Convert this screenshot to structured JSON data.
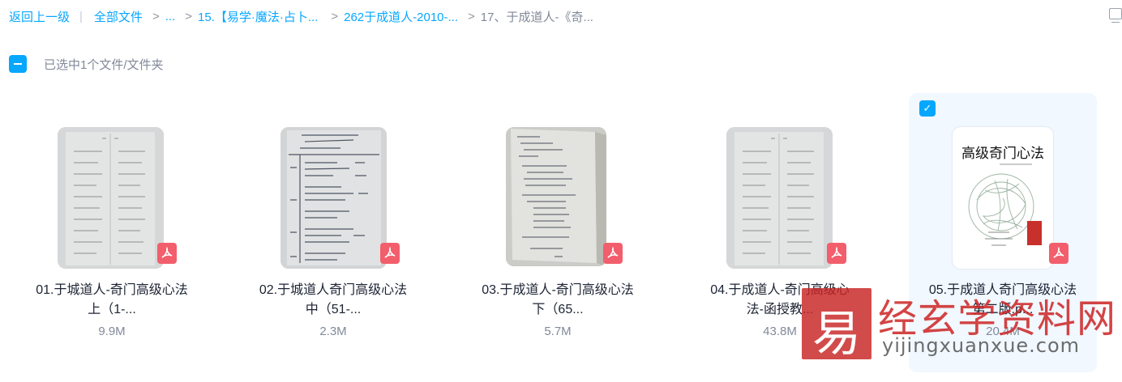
{
  "breadcrumb": {
    "back": "返回上一级",
    "all_files": "全部文件",
    "ellipsis": "...",
    "crumb_1": "15.【易学·魔法·占卜...",
    "crumb_2": "262于成道人-2010-...",
    "current": "17、于成道人-《奇..."
  },
  "selection": {
    "text": "已选中1个文件/文件夹"
  },
  "files": [
    {
      "line1": "01.于城道人-奇门高级心法",
      "line2": "上（1-...",
      "size": "9.9M"
    },
    {
      "line1": "02.于城道人奇门高级心法",
      "line2": "中（51-...",
      "size": "2.3M"
    },
    {
      "line1": "03.于成道人-奇门高级心法",
      "line2": "下（65...",
      "size": "5.7M"
    },
    {
      "line1": "04.于成道人-奇门高级心",
      "line2": "法-函授教...",
      "size": "43.8M"
    },
    {
      "line1": "05.于成道人奇门高级心法",
      "line2": "第二版.p...",
      "size": "20.4M",
      "selected": true
    }
  ],
  "cover": {
    "title": "高级奇门心法"
  },
  "watermark": {
    "logo_char": "易",
    "text": "经玄学资料网",
    "url": "yijingxuanxue.com"
  },
  "colors": {
    "accent": "#06a7ff",
    "pdf": "#f25e6c",
    "watermark": "#c82323"
  }
}
